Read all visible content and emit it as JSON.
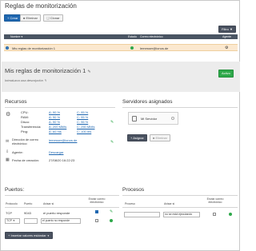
{
  "page": {
    "title": "Reglas de monitorización"
  },
  "toolbar": {
    "create": "Crear",
    "delete": "Eliminar",
    "clone": "Clonar",
    "filter": "Filtro"
  },
  "table": {
    "headers": {
      "name": "Nombre",
      "state": "Estado",
      "email": "Correo electrónico",
      "agent": "Agente"
    },
    "rows": [
      {
        "name": "Mis reglas de monitorización 1",
        "email": "lemesser@ionos.de"
      }
    ]
  },
  "detail": {
    "title": "Mis reglas de monitorización 1",
    "description": "Introduzca una descripción",
    "activate": "Activo"
  },
  "resources": {
    "title": "Recursos",
    "metrics": [
      {
        "label": "CPU:",
        "warn": "A: 90 %",
        "crit": "C: 95 %"
      },
      {
        "label": "RAM:",
        "warn": "A: 90 %",
        "crit": "C: 95 %"
      },
      {
        "label": "Disco:",
        "warn": "A: 90 %",
        "crit": "C: 96 %"
      },
      {
        "label": "Transferencia:",
        "warn": "A: 200 Mbits",
        "crit": "C: 250 Mbits"
      },
      {
        "label": "Ping:",
        "warn": "A: 60 ms",
        "crit": "C: 100 ms"
      }
    ],
    "email_label": "Dirección de correo electrónico:",
    "email_value": "lemesser@ionos.de",
    "agent_label": "Agente:",
    "agent_value": "Descargar",
    "date_label": "Fecha de creación:",
    "date_value": "27/08/20 16:22:23"
  },
  "servers": {
    "title": "Servidores asignados",
    "server_name": "Mi Servidor",
    "assign": "Asignar",
    "remove": "Eliminar"
  },
  "ports": {
    "title": "Puertos:",
    "headers": {
      "protocol": "Protocolo",
      "port": "Puerto",
      "alert": "Avisar si",
      "email": "Enviar correo electrónico"
    },
    "rows": [
      {
        "protocol": "TCP",
        "port": "9043",
        "alert": "el puerto responde"
      }
    ],
    "new_row": {
      "protocol": "TCP",
      "port": "",
      "alert": "el puerto no responde"
    },
    "insert_defaults": "Insertar valores estándar"
  },
  "processes": {
    "title": "Procesos",
    "headers": {
      "process": "Proceso",
      "alert": "Avisar si",
      "email": "Enviar correo electrónico"
    },
    "new_row": {
      "process": "",
      "alert": "no se está ejecutando"
    }
  },
  "colors": {
    "accent": "#1f67b0",
    "ok": "#2ea84a",
    "selected_row": "#fbe8cf",
    "table_head": "#4a5563"
  }
}
